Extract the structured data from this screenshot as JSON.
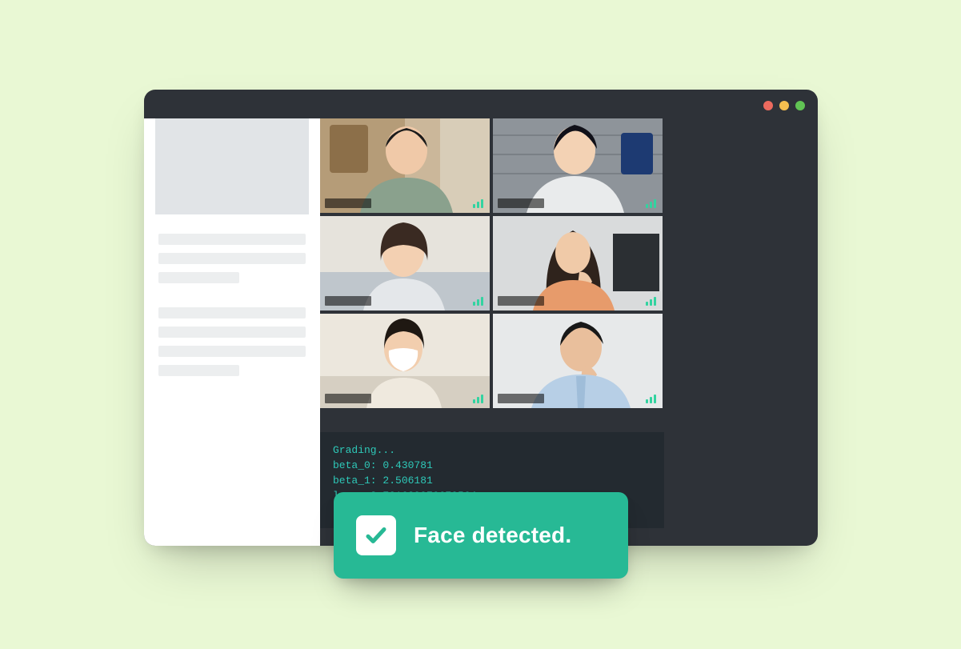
{
  "window": {
    "traffic_colors": {
      "red": "#ec6a5e",
      "yellow": "#f4be4f",
      "green": "#61c454"
    }
  },
  "terminal": {
    "lines": [
      "Grading...",
      "beta_0: 0.430781",
      "beta_1: 2.506181",
      "loss: 3.721639970679564"
    ]
  },
  "toast": {
    "label": "Face detected.",
    "icon": "check-icon",
    "accent": "#27b995"
  },
  "participants": [
    {
      "id": "p1"
    },
    {
      "id": "p2"
    },
    {
      "id": "p3"
    },
    {
      "id": "p4"
    },
    {
      "id": "p5"
    },
    {
      "id": "p6"
    }
  ]
}
